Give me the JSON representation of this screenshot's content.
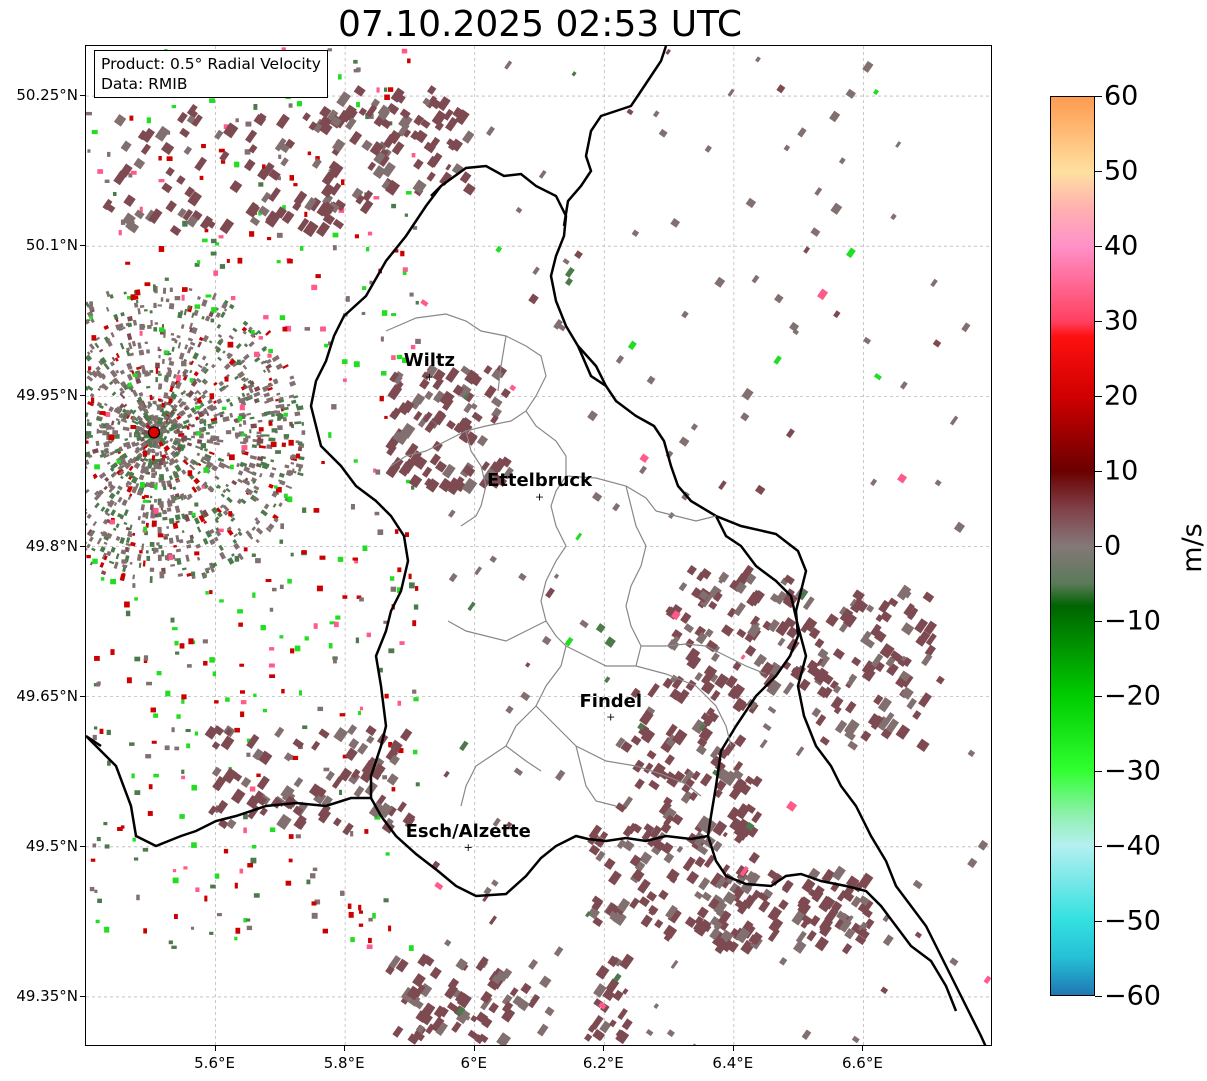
{
  "title": "07.10.2025 02:53 UTC",
  "infobox": {
    "product": "Product: 0.5° Radial Velocity",
    "data": "Data: RMIB"
  },
  "y_ticks": [
    {
      "label": "50.25°N",
      "lat": 50.25
    },
    {
      "label": "50.1°N",
      "lat": 50.1
    },
    {
      "label": "49.95°N",
      "lat": 49.95
    },
    {
      "label": "49.8°N",
      "lat": 49.8
    },
    {
      "label": "49.65°N",
      "lat": 49.65
    },
    {
      "label": "49.5°N",
      "lat": 49.5
    },
    {
      "label": "49.35°N",
      "lat": 49.35
    }
  ],
  "x_ticks": [
    {
      "label": "5.6°E",
      "lon": 5.6
    },
    {
      "label": "5.8°E",
      "lon": 5.8
    },
    {
      "label": "6°E",
      "lon": 6.0
    },
    {
      "label": "6.2°E",
      "lon": 6.2
    },
    {
      "label": "6.4°E",
      "lon": 6.4
    },
    {
      "label": "6.6°E",
      "lon": 6.6
    }
  ],
  "extent": {
    "lon_min": 5.4,
    "lon_max": 6.8,
    "lat_min": 49.3,
    "lat_max": 50.3
  },
  "cities": [
    {
      "name": "Wiltz",
      "lon": 5.93,
      "lat": 49.97
    },
    {
      "name": "Ettelbruck",
      "lon": 6.1,
      "lat": 49.85
    },
    {
      "name": "Findel",
      "lon": 6.21,
      "lat": 49.63
    },
    {
      "name": "Esch/Alzette",
      "lon": 5.99,
      "lat": 49.5
    }
  ],
  "radar_site": {
    "lon": 5.505,
    "lat": 49.914,
    "color": "#e00000"
  },
  "colorbar": {
    "label": "m/s",
    "min": -60,
    "max": 60,
    "ticks": [
      "60",
      "50",
      "40",
      "30",
      "20",
      "10",
      "0",
      "−10",
      "−20",
      "−30",
      "−40",
      "−50",
      "−60"
    ],
    "stops": [
      {
        "v": -60,
        "c": "#1f77b4"
      },
      {
        "v": -55,
        "c": "#25c0d6"
      },
      {
        "v": -50,
        "c": "#33e0e0"
      },
      {
        "v": -40,
        "c": "#b4f0f0"
      },
      {
        "v": -36,
        "c": "#90f0b0"
      },
      {
        "v": -30,
        "c": "#30ff30"
      },
      {
        "v": -20,
        "c": "#00cc00"
      },
      {
        "v": -8,
        "c": "#006400"
      },
      {
        "v": -5,
        "c": "#5a7a5a"
      },
      {
        "v": 0,
        "c": "#857878"
      },
      {
        "v": 5,
        "c": "#804048"
      },
      {
        "v": 10,
        "c": "#6a0000"
      },
      {
        "v": 20,
        "c": "#d00000"
      },
      {
        "v": 28,
        "c": "#ff1010"
      },
      {
        "v": 30,
        "c": "#ff4060"
      },
      {
        "v": 40,
        "c": "#ff90c8"
      },
      {
        "v": 45,
        "c": "#ffb0b0"
      },
      {
        "v": 50,
        "c": "#ffe0a0"
      },
      {
        "v": 60,
        "c": "#ff9a50"
      }
    ]
  },
  "colors": {
    "neutral": "#827070",
    "green_dark": "#4d7a4d",
    "maroon": "#7e4a52",
    "red": "#cc0000",
    "green": "#22dd22",
    "pink": "#ff5a8a",
    "cyan": "#40e0e0"
  }
}
